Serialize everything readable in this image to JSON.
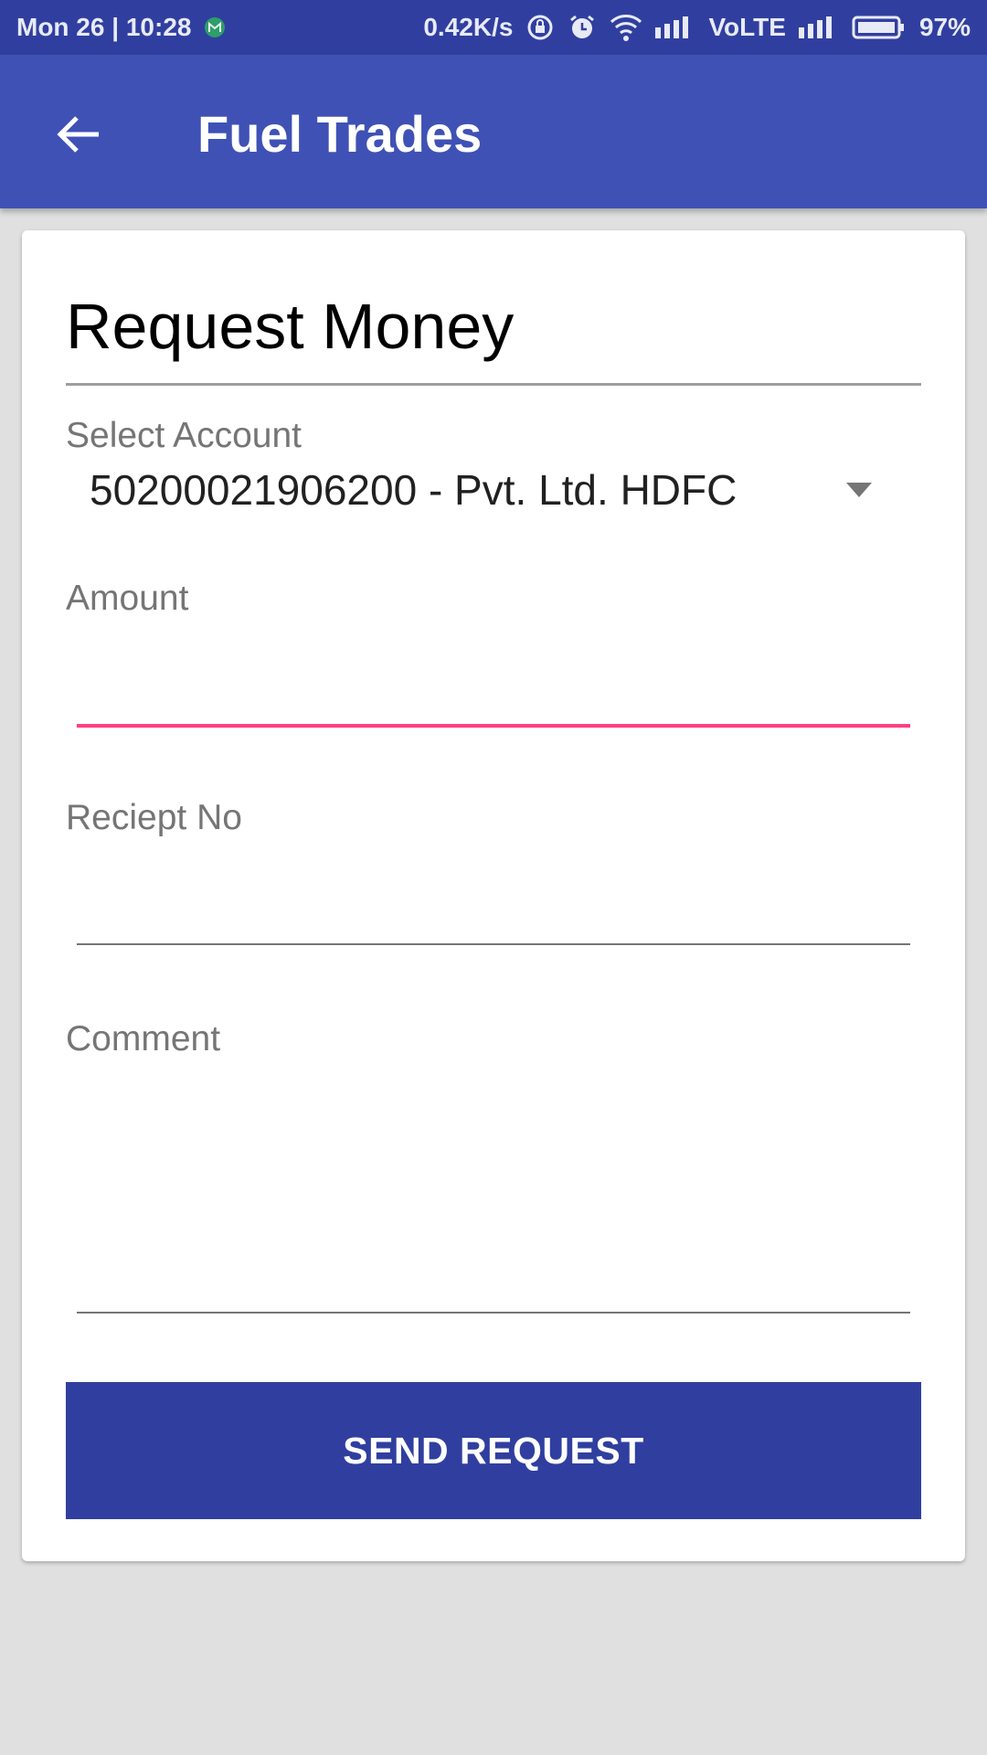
{
  "status_bar": {
    "datetime": "Mon 26 | 10:28",
    "speed": "0.42K/s",
    "network": "VoLTE",
    "battery": "97%"
  },
  "app_bar": {
    "title": "Fuel Trades"
  },
  "form": {
    "heading": "Request Money",
    "account_label": "Select Account",
    "account_value": "50200021906200 - Pvt. Ltd. HDFC",
    "amount_label": "Amount",
    "amount_value": "",
    "receipt_label": "Reciept No",
    "receipt_value": "",
    "comment_label": "Comment",
    "comment_value": "",
    "send_label": "SEND REQUEST"
  },
  "colors": {
    "primary": "#3f51b5",
    "primary_dark": "#303f9f",
    "accent": "#ff4081"
  }
}
